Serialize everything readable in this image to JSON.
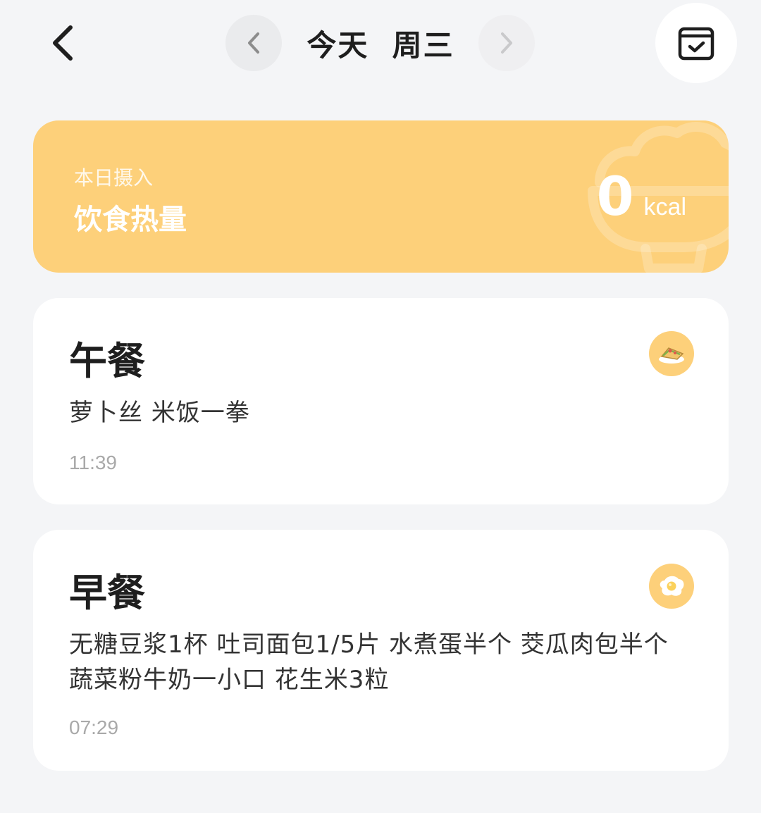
{
  "header": {
    "date_title": "今天  周三",
    "back_icon": "chevron-left-icon",
    "prev_icon": "chevron-left-icon",
    "next_icon": "chevron-right-icon",
    "calendar_icon": "calendar-check-icon"
  },
  "summary": {
    "label": "本日摄入",
    "title": "饮食热量",
    "value": "0",
    "unit": "kcal",
    "background_icon": "rice-bowl-icon",
    "color": "#fdd07a"
  },
  "meals": [
    {
      "title": "午餐",
      "description": "萝卜丝 米饭一拳",
      "time": "11:39",
      "icon": "sandwich-icon"
    },
    {
      "title": "早餐",
      "description": "无糖豆浆1杯 吐司面包1/5片  水煮蛋半个 茭瓜肉包半个 蔬菜粉牛奶一小口 花生米3粒",
      "time": "07:29",
      "icon": "fried-egg-icon"
    }
  ]
}
